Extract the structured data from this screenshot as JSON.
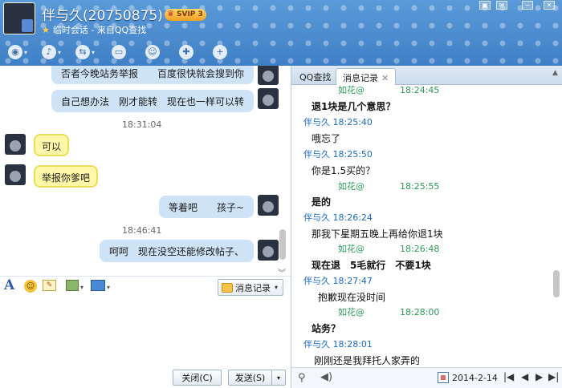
{
  "window": {
    "title": "伴与久(20750875)",
    "badge": "SVIP 3",
    "subtitle": "临时会话 - 来自QQ查找"
  },
  "toolbar_icons": [
    "video-call-icon",
    "voice-call-icon",
    "file-transfer-icon",
    "remote-assist-icon",
    "app-icon",
    "add-contact-icon",
    "invite-icon"
  ],
  "chat": {
    "messages": [
      {
        "side": "right",
        "text": "否者今晚站务举报　　百度很快就会搜到你"
      },
      {
        "side": "right",
        "text": "自己想办法　刚才能转　现在也一样可以转"
      },
      {
        "type": "time",
        "text": "18:31:04"
      },
      {
        "side": "left",
        "text": "可以"
      },
      {
        "side": "left",
        "text": "举报你爹吧"
      },
      {
        "side": "right",
        "text": "等着吧　　孩子~"
      },
      {
        "type": "time",
        "text": "18:46:41"
      },
      {
        "side": "right",
        "text": "呵呵　现在没空还能修改帖子、"
      }
    ]
  },
  "input_toolbar": {
    "history_label": "消息记录"
  },
  "buttons": {
    "close": "关闭(C)",
    "send": "发送(S)"
  },
  "panel": {
    "tabs": [
      "QQ查找",
      "消息记录"
    ],
    "log": [
      {
        "kind": "header",
        "sender": "如花@",
        "time": "18:24:45",
        "color": "green"
      },
      {
        "kind": "msg",
        "text": "退1块是几个意思？",
        "bold": true
      },
      {
        "kind": "header",
        "sender": "伴与久",
        "time": "18:25:40",
        "color": "blue"
      },
      {
        "kind": "msg",
        "text": "哦忘了",
        "bold": false
      },
      {
        "kind": "header",
        "sender": "伴与久",
        "time": "18:25:50",
        "color": "blue"
      },
      {
        "kind": "msg",
        "text": "你是1.5买的？",
        "bold": false
      },
      {
        "kind": "header",
        "sender": "如花@",
        "time": "18:25:55",
        "color": "green"
      },
      {
        "kind": "msg",
        "text": "是的",
        "bold": true
      },
      {
        "kind": "header",
        "sender": "伴与久",
        "time": "18:26:24",
        "color": "blue"
      },
      {
        "kind": "msg",
        "text": "那我下星期五晚上再给你退1块",
        "bold": false
      },
      {
        "kind": "header",
        "sender": "如花@",
        "time": "18:26:48",
        "color": "green"
      },
      {
        "kind": "msg",
        "text": "现在退　5毛就行　不要1块",
        "bold": true
      },
      {
        "kind": "header",
        "sender": "伴与久",
        "time": "18:27:47",
        "color": "blue"
      },
      {
        "kind": "msg",
        "text": "抱歉现在没时间",
        "bold": false
      },
      {
        "kind": "header",
        "sender": "如花@",
        "time": "18:28:00",
        "color": "green"
      },
      {
        "kind": "msg",
        "text": "站务？",
        "bold": true
      },
      {
        "kind": "header",
        "sender": "伴与久",
        "time": "18:28:01",
        "color": "blue"
      },
      {
        "kind": "msg",
        "text": "刚刚还是我拜托人家弄的",
        "bold": false
      }
    ],
    "date": "2014-2-14"
  }
}
